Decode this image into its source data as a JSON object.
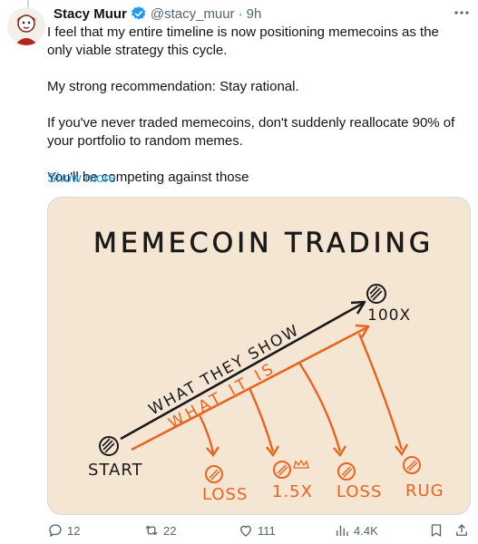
{
  "tweet": {
    "author_name": "Stacy Muur",
    "handle": "@stacy_muur",
    "separator": "·",
    "time": "9h",
    "paragraphs": [
      "I feel that my entire timeline is now positioning memecoins as the only viable strategy this cycle.",
      "My strong recommendation: Stay rational.",
      "If you've never traded memecoins, don't suddenly reallocate 90% of your portfolio to random memes.",
      "You'll be competing against those"
    ],
    "show_more": "Show more"
  },
  "image": {
    "title": "MEMECOIN TRADING",
    "labels": {
      "start": "START",
      "target": "100X",
      "what_they_show": "WHAT THEY SHOW",
      "what_it_is": "WHAT IT IS",
      "outcomes": [
        "LOSS",
        "1.5X",
        "LOSS",
        "RUG"
      ]
    },
    "colors": {
      "background": "#f5e6d3",
      "orange": "#e8641e",
      "ink": "#1a1a1a"
    }
  },
  "actions": {
    "replies": "12",
    "reposts": "22",
    "likes": "111",
    "views": "4.4K"
  },
  "icons": [
    "verified-badge-icon",
    "more-icon",
    "reply-icon",
    "repost-icon",
    "like-icon",
    "views-icon",
    "bookmark-icon",
    "share-icon"
  ],
  "colors": {
    "accent": "#1d9bf0",
    "secondary_text": "#536471",
    "border": "#cfd9de"
  }
}
